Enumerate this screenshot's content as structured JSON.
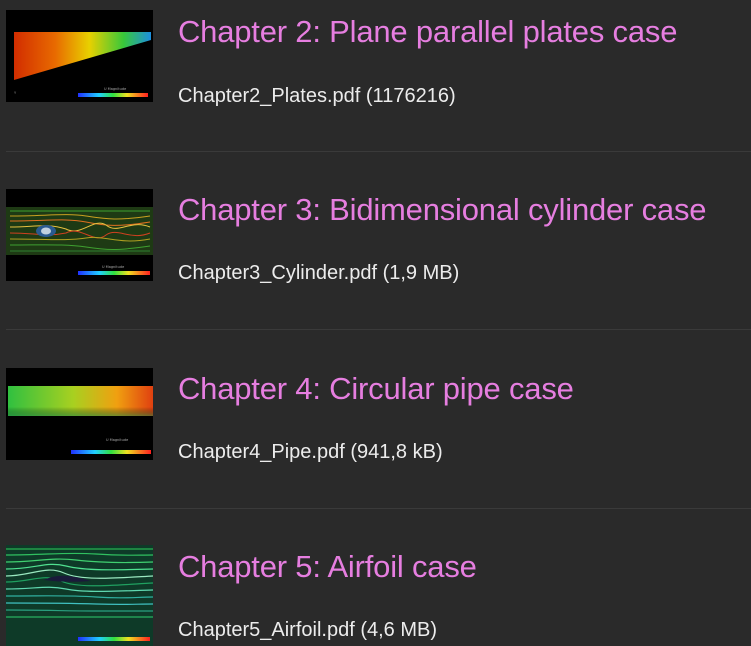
{
  "colors": {
    "background": "#2a2a2a",
    "title": "#e67ee0",
    "file": "#ececec",
    "divider": "#3a3a3a"
  },
  "chapters": [
    {
      "title": "Chapter 2: Plane parallel plates case",
      "file": "Chapter2_Plates.pdf (1176216)",
      "thumbnail": "plates-flow-thumbnail"
    },
    {
      "title": "Chapter 3: Bidimensional cylinder case",
      "file": "Chapter3_Cylinder.pdf (1,9 MB)",
      "thumbnail": "cylinder-flow-thumbnail"
    },
    {
      "title": "Chapter 4: Circular pipe case",
      "file": "Chapter4_Pipe.pdf (941,8 kB)",
      "thumbnail": "pipe-flow-thumbnail"
    },
    {
      "title": "Chapter 5: Airfoil case",
      "file": "Chapter5_Airfoil.pdf (4,6 MB)",
      "thumbnail": "airfoil-flow-thumbnail"
    }
  ]
}
